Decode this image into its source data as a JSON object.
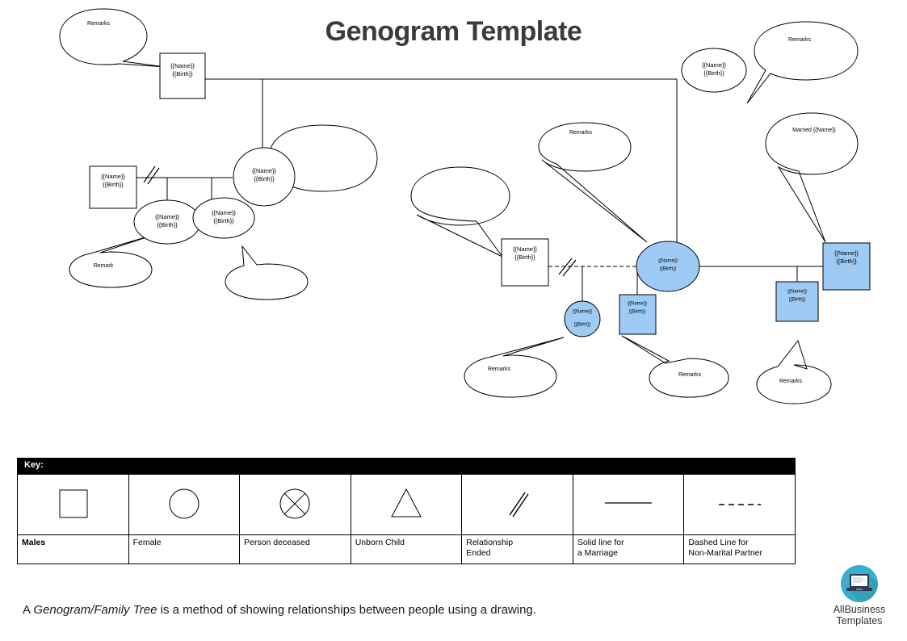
{
  "document": {
    "title": "Genogram Template",
    "footer_note_prefix": "A ",
    "footer_note_italic": "Genogram/Family Tree",
    "footer_note_suffix": " is a method of showing relationships between people using a drawing."
  },
  "colors": {
    "title": "#3b3b3b",
    "node_fill_white": "#ffffff",
    "node_fill_blue": "#9ecbf5",
    "stroke": "#000000",
    "key_header_bg": "#000000",
    "key_header_text": "#ffffff",
    "logo_circle": "#3aafc9",
    "logo_laptop": "#2b3a52"
  },
  "genogram": {
    "person_label_name": "{{Name}}",
    "person_label_birth": "{{Birth}}",
    "nodes": [
      {
        "id": "n1",
        "shape": "square",
        "fill": "white",
        "name": "{{Name}}",
        "birth": "{{Birth}}"
      },
      {
        "id": "n2",
        "shape": "square",
        "fill": "white",
        "name": "{{Name}}",
        "birth": "{{Birth}}"
      },
      {
        "id": "n3",
        "shape": "circle",
        "fill": "white",
        "name": "{{Name}}",
        "birth": "{{Birth}}"
      },
      {
        "id": "n4",
        "shape": "circle",
        "fill": "white",
        "name": "{{Name}}",
        "birth": "{{Birth}}"
      },
      {
        "id": "n5",
        "shape": "circle",
        "fill": "white",
        "name": "{{Name}}",
        "birth": "{{Birth}}"
      },
      {
        "id": "n6",
        "shape": "square",
        "fill": "white",
        "name": "{{Name}}",
        "birth": "{{Birth}}"
      },
      {
        "id": "n7",
        "shape": "circle",
        "fill": "white",
        "name": "{{Name}}",
        "birth": "{{Birth}}"
      },
      {
        "id": "n8",
        "shape": "circle",
        "fill": "blue",
        "name": "{{Name}}",
        "birth": "{{Birth}}"
      },
      {
        "id": "n9",
        "shape": "circle",
        "fill": "blue",
        "name": "{{Name}}",
        "birth": "{{Birth}}"
      },
      {
        "id": "n10",
        "shape": "square",
        "fill": "blue",
        "name": "{{Name}}",
        "birth": "{{Birth}}"
      },
      {
        "id": "n11",
        "shape": "square",
        "fill": "blue",
        "name": "{{Name}}",
        "birth": "{{Birth}}"
      },
      {
        "id": "n12",
        "shape": "square",
        "fill": "blue",
        "name": "{{Name}}",
        "birth": "{{Birth}}"
      }
    ],
    "bubbles": [
      {
        "id": "b1",
        "text": "Remarks"
      },
      {
        "id": "b2",
        "text": "Remarks"
      },
      {
        "id": "b3",
        "text": "Remarks"
      },
      {
        "id": "b4",
        "text": "Remark"
      },
      {
        "id": "b5",
        "text": ""
      },
      {
        "id": "b6",
        "text": ""
      },
      {
        "id": "b7",
        "text": ""
      },
      {
        "id": "b8",
        "text": "Married {{Name}}"
      },
      {
        "id": "b9",
        "text": "Remarks"
      },
      {
        "id": "b10",
        "text": "Remarks"
      },
      {
        "id": "b11",
        "text": "Remarks"
      },
      {
        "id": "b12",
        "text": "Remarks"
      }
    ]
  },
  "key": {
    "header_label": "Key:",
    "columns": [
      {
        "symbol": "square",
        "label_line1": "Males",
        "label_line2": "",
        "bold": true
      },
      {
        "symbol": "circle",
        "label_line1": "Female",
        "label_line2": "",
        "bold": false
      },
      {
        "symbol": "crossed",
        "label_line1": "Person deceased",
        "label_line2": "",
        "bold": false
      },
      {
        "symbol": "triangle",
        "label_line1": "Unborn Child",
        "label_line2": "",
        "bold": false
      },
      {
        "symbol": "double-slash",
        "label_line1": "Relationship",
        "label_line2": "Ended",
        "bold": false
      },
      {
        "symbol": "solid-line",
        "label_line1": "Solid line for",
        "label_line2": "a Marriage",
        "bold": false
      },
      {
        "symbol": "dashed-line",
        "label_line1": "Dashed Line for",
        "label_line2": "Non-Marital Partner",
        "bold": false
      }
    ]
  },
  "logo": {
    "line1": "AllBusiness",
    "line2": "Templates"
  }
}
